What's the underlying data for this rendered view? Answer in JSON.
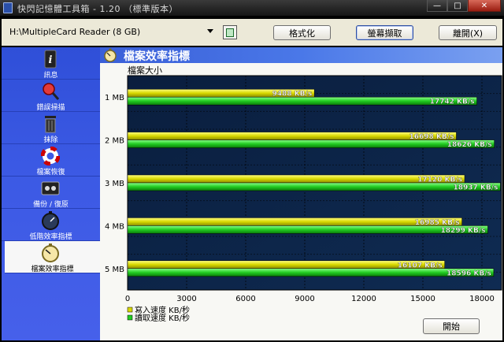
{
  "window": {
    "title": "快閃記憶體工具箱 - 1.20 （標準版本）"
  },
  "toolbar": {
    "device": "H:\\MultipleCard  Reader (8 GB)",
    "format_label": "格式化",
    "screenshot_label": "螢幕擷取",
    "exit_label": "離開(X)"
  },
  "sidebar": {
    "items": [
      {
        "label": "訊息",
        "icon": "info-icon"
      },
      {
        "label": "錯誤掃描",
        "icon": "magnifier-icon"
      },
      {
        "label": "抹除",
        "icon": "trash-icon"
      },
      {
        "label": "檔案恢復",
        "icon": "lifebuoy-icon"
      },
      {
        "label": "備份 / 復原",
        "icon": "cassette-icon"
      },
      {
        "label": "低階效率指標",
        "icon": "stopwatch-icon"
      },
      {
        "label": "檔案效率指標",
        "icon": "stopwatch-icon"
      }
    ],
    "active_index": 6
  },
  "panel": {
    "title": "檔案效率指標",
    "start_label": "開始"
  },
  "colors": {
    "write": "#d8d800",
    "read": "#22cc22",
    "plot_bg": "#0f2b52",
    "sidebar": "#3b59e4"
  },
  "chart_data": {
    "type": "bar",
    "orientation": "horizontal",
    "ylabel": "檔案大小",
    "categories": [
      "1 MB",
      "2 MB",
      "3 MB",
      "4 MB",
      "5 MB"
    ],
    "series": [
      {
        "name": "寫入速度 KB/秒",
        "values": [
          9488,
          16698,
          17120,
          16985,
          16107
        ],
        "labels": [
          "9488 KB/s",
          "16698 KB/s",
          "17120 KB/s",
          "16985 KB/s",
          "16107 KB/s"
        ]
      },
      {
        "name": "讀取速度 KB/秒",
        "values": [
          17742,
          18626,
          18937,
          18299,
          18596
        ],
        "labels": [
          "17742 KB/s",
          "18626 KB/s",
          "18937 KB/s",
          "18299 KB/s",
          "18596 KB/s"
        ]
      }
    ],
    "xlim": [
      0,
      19000
    ],
    "xticks": [
      "0",
      "3000",
      "6000",
      "9000",
      "12000",
      "15000",
      "18000"
    ],
    "legend_position": "bottom-left",
    "grid": true
  }
}
